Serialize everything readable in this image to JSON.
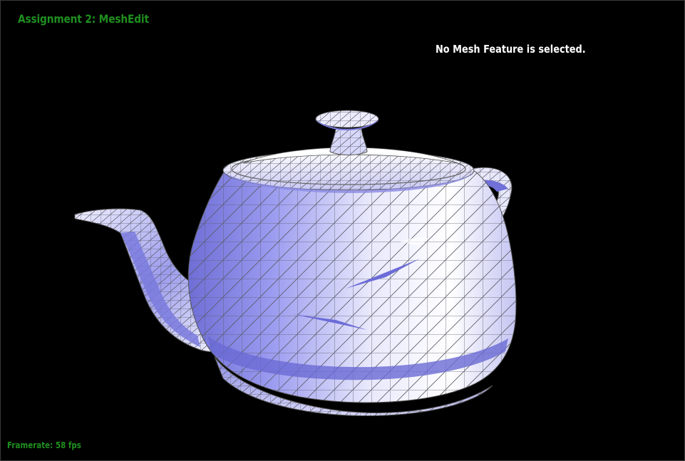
{
  "app": {
    "title": "Assignment 2: MeshEdit"
  },
  "status": {
    "selection_message": "No Mesh Feature is selected."
  },
  "footer": {
    "framerate_label": "Framerate: 58 fps"
  },
  "scene": {
    "model": "teapot-mesh",
    "colors": {
      "background": "#000000",
      "mesh_light": "#f4f4ff",
      "mesh_mid": "#b9b9f6",
      "mesh_dark": "#7070d8",
      "wireframe": "#5a5a5a",
      "hud_green": "#1f8f1f"
    }
  }
}
